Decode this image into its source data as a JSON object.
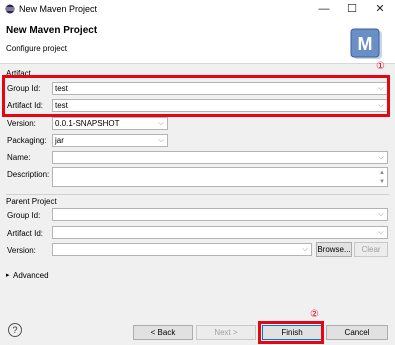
{
  "window": {
    "title": "New Maven Project",
    "minimize_glyph": "—",
    "maximize_glyph": "☐",
    "close_glyph": "✕"
  },
  "header": {
    "title": "New Maven Project",
    "subtitle": "Configure project",
    "logo_letter": "M"
  },
  "artifact": {
    "section_label": "Artifact",
    "group_id": {
      "label": "Group Id:",
      "value": "test"
    },
    "artifact_id": {
      "label": "Artifact Id:",
      "value": "test"
    },
    "version": {
      "label": "Version:",
      "value": "0.0.1-SNAPSHOT"
    },
    "packaging": {
      "label": "Packaging:",
      "value": "jar"
    },
    "name": {
      "label": "Name:",
      "value": ""
    },
    "description": {
      "label": "Description:",
      "value": ""
    }
  },
  "parent": {
    "section_label": "Parent Project",
    "group_id": {
      "label": "Group Id:",
      "value": ""
    },
    "artifact_id": {
      "label": "Artifact Id:",
      "value": ""
    },
    "version": {
      "label": "Version:",
      "value": ""
    },
    "browse_label": "Browse...",
    "clear_label": "Clear"
  },
  "advanced": {
    "label": "Advanced"
  },
  "footer": {
    "help_glyph": "?",
    "back_label": "< Back",
    "next_label": "Next >",
    "finish_label": "Finish",
    "cancel_label": "Cancel"
  },
  "annotations": {
    "badge_1": "①",
    "badge_2": "②",
    "color": "#e30613"
  },
  "icons": {
    "dropdown": "chevron-down-icon",
    "expand": "triangle-right-icon"
  }
}
